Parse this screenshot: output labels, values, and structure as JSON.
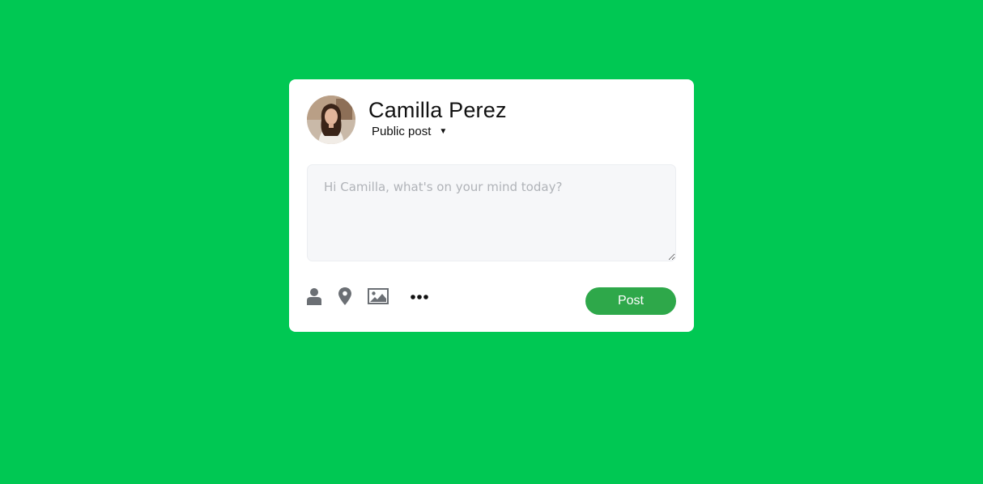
{
  "user": {
    "name": "Camilla Perez",
    "privacy_label": "Public post"
  },
  "composer": {
    "placeholder": "Hi Camilla, what's on your mind today?",
    "value": ""
  },
  "toolbar": {
    "icons": [
      "person-icon",
      "location-pin-icon",
      "image-icon",
      "more-icon"
    ],
    "post_label": "Post"
  },
  "colors": {
    "background": "#00c853",
    "post_button": "#2ea84a",
    "icon": "#6b6f74"
  }
}
